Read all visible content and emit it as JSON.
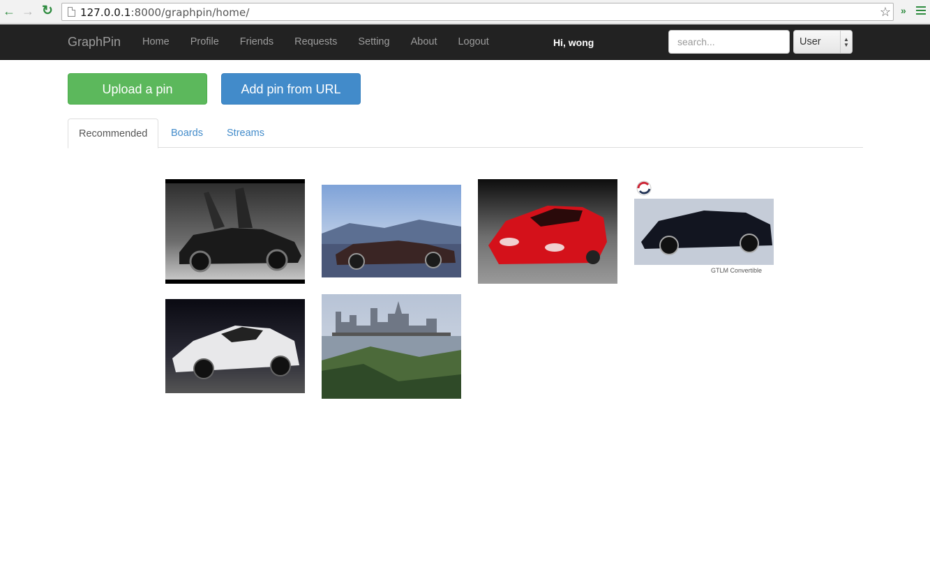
{
  "browser": {
    "url_host": "127.0.0.1",
    "url_rest": ":8000/graphpin/home/",
    "icons": [
      "back-arrow-icon",
      "forward-arrow-icon",
      "reload-icon",
      "page-icon",
      "star-icon",
      "extensions-chevron-icon",
      "menu-icon"
    ]
  },
  "navbar": {
    "brand": "GraphPin",
    "links": [
      "Home",
      "Profile",
      "Friends",
      "Requests",
      "Setting",
      "About",
      "Logout"
    ],
    "greeting": "Hi, wong",
    "search_placeholder": "search...",
    "search_type": "User"
  },
  "actions": {
    "upload": "Upload a pin",
    "add_url": "Add pin from URL"
  },
  "tabs": {
    "recommended": "Recommended",
    "boards": "Boards",
    "streams": "Streams"
  },
  "pins": {
    "caption_gtlm": "GTLM Convertible"
  },
  "colors": {
    "navbar": "#222222",
    "green": "#5cb85c",
    "blue": "#428bca"
  }
}
